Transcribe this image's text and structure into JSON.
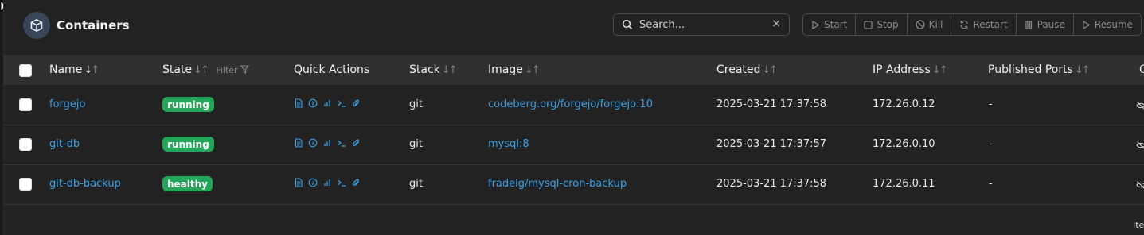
{
  "header": {
    "title": "Containers",
    "icon": "cube-icon"
  },
  "search": {
    "placeholder": "Search...",
    "clear": "×"
  },
  "actions": [
    "Start",
    "Stop",
    "Kill",
    "Restart",
    "Pause",
    "Resume"
  ],
  "columns": {
    "name": "Name",
    "state": "State",
    "filter": "Filter",
    "quick_actions": "Quick Actions",
    "stack": "Stack",
    "image": "Image",
    "created": "Created",
    "ip": "IP Address",
    "ports": "Published Ports",
    "extra": "O"
  },
  "rows": [
    {
      "name": "forgejo",
      "state": "running",
      "stack": "git",
      "image": "codeberg.org/forgejo/forgejo:10",
      "created": "2025-03-21 17:37:58",
      "ip": "172.26.0.12",
      "ports": "-"
    },
    {
      "name": "git-db",
      "state": "running",
      "stack": "git",
      "image": "mysql:8",
      "created": "2025-03-21 17:37:57",
      "ip": "172.26.0.10",
      "ports": "-"
    },
    {
      "name": "git-db-backup",
      "state": "healthy",
      "stack": "git",
      "image": "fradelg/mysql-cron-backup",
      "created": "2025-03-21 17:37:58",
      "ip": "172.26.0.11",
      "ports": "-"
    }
  ],
  "footer": {
    "text": "Ite"
  },
  "colors": {
    "accent": "#3aa0e6",
    "status": "#23a55a",
    "header_bg": "#303030",
    "panel_bg": "#222222"
  }
}
